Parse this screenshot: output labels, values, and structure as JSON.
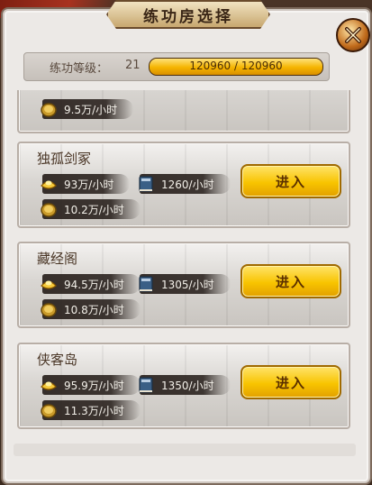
{
  "header": {
    "title": "练功房选择"
  },
  "level": {
    "label": "练功等级：",
    "value": "21",
    "progress_text": "120960 / 120960",
    "progress_fraction": 1.0
  },
  "rooms": [
    {
      "partial": true,
      "coin_rate": "9.5万/小时"
    },
    {
      "name": "独孤剑冢",
      "gold_rate": "93万/小时",
      "exp_rate": "1260/小时",
      "coin_rate": "10.2万/小时",
      "enter_label": "进入"
    },
    {
      "name": "藏经阁",
      "gold_rate": "94.5万/小时",
      "exp_rate": "1305/小时",
      "coin_rate": "10.8万/小时",
      "enter_label": "进入"
    },
    {
      "name": "侠客岛",
      "gold_rate": "95.9万/小时",
      "exp_rate": "1350/小时",
      "coin_rate": "11.3万/小时",
      "enter_label": "进入"
    }
  ],
  "icons": {
    "close": "close-icon",
    "gold": "gold-ingot-icon",
    "exp": "book-icon",
    "coin": "coin-icon"
  },
  "colors": {
    "accent_gold": "#f8c400",
    "panel_bg": "#ece9e6",
    "ink": "#2a201c"
  }
}
